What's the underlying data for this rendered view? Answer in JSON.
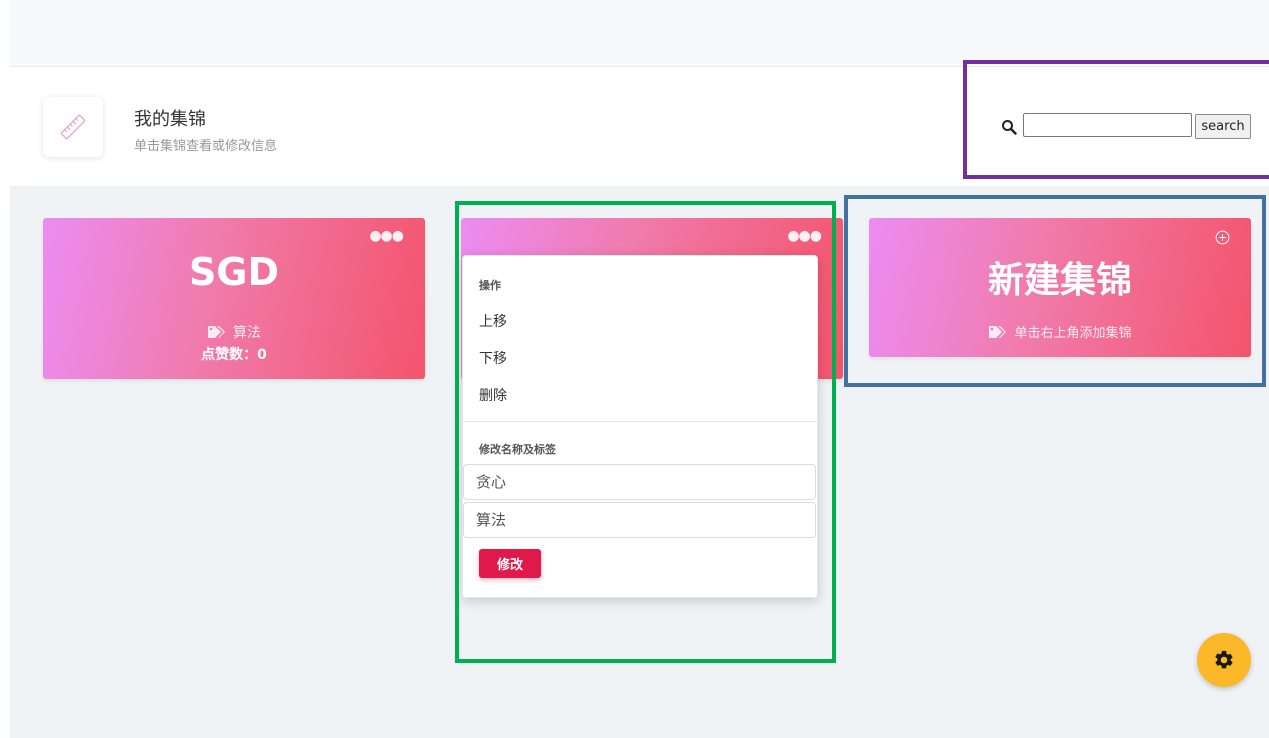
{
  "header": {
    "title": "我的集锦",
    "subtitle": "单击集锦查看或修改信息"
  },
  "search": {
    "value": "",
    "button_label": "search"
  },
  "cards": [
    {
      "title": "SGD",
      "tag": "算法",
      "likes_label": "点赞数：0",
      "menu_icon": "ellipsis-icon"
    },
    {
      "title": "",
      "menu_icon": "ellipsis-icon"
    }
  ],
  "new_card": {
    "title": "新建集锦",
    "hint": "单击右上角添加集锦",
    "add_icon": "circle-plus-icon"
  },
  "dropdown": {
    "actions_header": "操作",
    "items": [
      "上移",
      "下移",
      "删除"
    ],
    "edit_header": "修改名称及标签",
    "name_value": "贪心",
    "tag_value": "算法",
    "submit_label": "修改"
  },
  "colors": {
    "card_gradient_start": "#ec8cf3",
    "card_gradient_end": "#f4546c",
    "submit_button": "#e0194b",
    "fab": "#fbb829",
    "highlight_purple": "#7030a0",
    "highlight_green": "#00b050",
    "highlight_blue": "#4472a0"
  },
  "icons": {
    "logo": "ruler-icon",
    "search": "search-icon",
    "tag": "tags-icon",
    "fab": "gear-icon"
  }
}
